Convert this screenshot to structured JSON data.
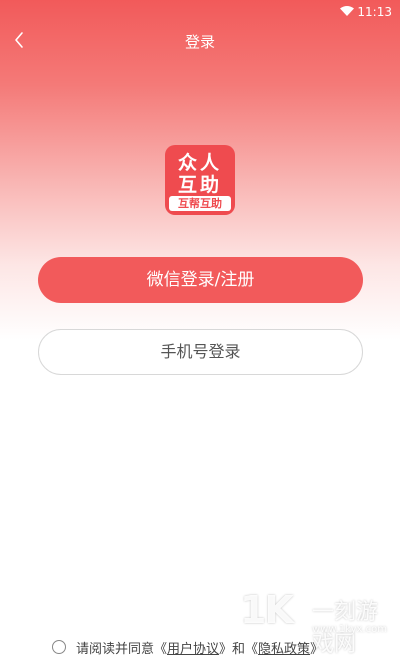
{
  "status_bar": {
    "time": "11:13"
  },
  "nav": {
    "title": "登录"
  },
  "logo": {
    "line1": "众人",
    "line2": "互助",
    "ribbon": "互帮互助"
  },
  "buttons": {
    "wechat_login": "微信登录/注册",
    "phone_login": "手机号登录"
  },
  "agreement": {
    "prefix": "请阅读并同意《",
    "user_agreement": "用户协议",
    "middle": "》和《",
    "privacy_policy": "隐私政策",
    "suffix": "》"
  },
  "watermark": {
    "mark": "1K",
    "text": "一刻游戏网",
    "url": "www.1kyx.com"
  },
  "colors": {
    "primary": "#f25a5b",
    "logo_bg": "#ef4b4f",
    "text": "#444444"
  }
}
